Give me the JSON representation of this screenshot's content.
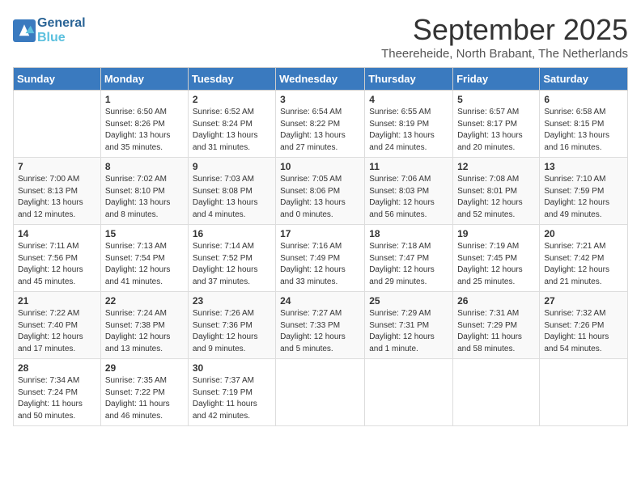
{
  "header": {
    "logo": {
      "line1": "General",
      "line2": "Blue"
    },
    "title": "September 2025",
    "location": "Theereheide, North Brabant, The Netherlands"
  },
  "days": [
    "Sunday",
    "Monday",
    "Tuesday",
    "Wednesday",
    "Thursday",
    "Friday",
    "Saturday"
  ],
  "weeks": [
    [
      {
        "num": "",
        "info": ""
      },
      {
        "num": "1",
        "info": "Sunrise: 6:50 AM\nSunset: 8:26 PM\nDaylight: 13 hours\nand 35 minutes."
      },
      {
        "num": "2",
        "info": "Sunrise: 6:52 AM\nSunset: 8:24 PM\nDaylight: 13 hours\nand 31 minutes."
      },
      {
        "num": "3",
        "info": "Sunrise: 6:54 AM\nSunset: 8:22 PM\nDaylight: 13 hours\nand 27 minutes."
      },
      {
        "num": "4",
        "info": "Sunrise: 6:55 AM\nSunset: 8:19 PM\nDaylight: 13 hours\nand 24 minutes."
      },
      {
        "num": "5",
        "info": "Sunrise: 6:57 AM\nSunset: 8:17 PM\nDaylight: 13 hours\nand 20 minutes."
      },
      {
        "num": "6",
        "info": "Sunrise: 6:58 AM\nSunset: 8:15 PM\nDaylight: 13 hours\nand 16 minutes."
      }
    ],
    [
      {
        "num": "7",
        "info": "Sunrise: 7:00 AM\nSunset: 8:13 PM\nDaylight: 13 hours\nand 12 minutes."
      },
      {
        "num": "8",
        "info": "Sunrise: 7:02 AM\nSunset: 8:10 PM\nDaylight: 13 hours\nand 8 minutes."
      },
      {
        "num": "9",
        "info": "Sunrise: 7:03 AM\nSunset: 8:08 PM\nDaylight: 13 hours\nand 4 minutes."
      },
      {
        "num": "10",
        "info": "Sunrise: 7:05 AM\nSunset: 8:06 PM\nDaylight: 13 hours\nand 0 minutes."
      },
      {
        "num": "11",
        "info": "Sunrise: 7:06 AM\nSunset: 8:03 PM\nDaylight: 12 hours\nand 56 minutes."
      },
      {
        "num": "12",
        "info": "Sunrise: 7:08 AM\nSunset: 8:01 PM\nDaylight: 12 hours\nand 52 minutes."
      },
      {
        "num": "13",
        "info": "Sunrise: 7:10 AM\nSunset: 7:59 PM\nDaylight: 12 hours\nand 49 minutes."
      }
    ],
    [
      {
        "num": "14",
        "info": "Sunrise: 7:11 AM\nSunset: 7:56 PM\nDaylight: 12 hours\nand 45 minutes."
      },
      {
        "num": "15",
        "info": "Sunrise: 7:13 AM\nSunset: 7:54 PM\nDaylight: 12 hours\nand 41 minutes."
      },
      {
        "num": "16",
        "info": "Sunrise: 7:14 AM\nSunset: 7:52 PM\nDaylight: 12 hours\nand 37 minutes."
      },
      {
        "num": "17",
        "info": "Sunrise: 7:16 AM\nSunset: 7:49 PM\nDaylight: 12 hours\nand 33 minutes."
      },
      {
        "num": "18",
        "info": "Sunrise: 7:18 AM\nSunset: 7:47 PM\nDaylight: 12 hours\nand 29 minutes."
      },
      {
        "num": "19",
        "info": "Sunrise: 7:19 AM\nSunset: 7:45 PM\nDaylight: 12 hours\nand 25 minutes."
      },
      {
        "num": "20",
        "info": "Sunrise: 7:21 AM\nSunset: 7:42 PM\nDaylight: 12 hours\nand 21 minutes."
      }
    ],
    [
      {
        "num": "21",
        "info": "Sunrise: 7:22 AM\nSunset: 7:40 PM\nDaylight: 12 hours\nand 17 minutes."
      },
      {
        "num": "22",
        "info": "Sunrise: 7:24 AM\nSunset: 7:38 PM\nDaylight: 12 hours\nand 13 minutes."
      },
      {
        "num": "23",
        "info": "Sunrise: 7:26 AM\nSunset: 7:36 PM\nDaylight: 12 hours\nand 9 minutes."
      },
      {
        "num": "24",
        "info": "Sunrise: 7:27 AM\nSunset: 7:33 PM\nDaylight: 12 hours\nand 5 minutes."
      },
      {
        "num": "25",
        "info": "Sunrise: 7:29 AM\nSunset: 7:31 PM\nDaylight: 12 hours\nand 1 minute."
      },
      {
        "num": "26",
        "info": "Sunrise: 7:31 AM\nSunset: 7:29 PM\nDaylight: 11 hours\nand 58 minutes."
      },
      {
        "num": "27",
        "info": "Sunrise: 7:32 AM\nSunset: 7:26 PM\nDaylight: 11 hours\nand 54 minutes."
      }
    ],
    [
      {
        "num": "28",
        "info": "Sunrise: 7:34 AM\nSunset: 7:24 PM\nDaylight: 11 hours\nand 50 minutes."
      },
      {
        "num": "29",
        "info": "Sunrise: 7:35 AM\nSunset: 7:22 PM\nDaylight: 11 hours\nand 46 minutes."
      },
      {
        "num": "30",
        "info": "Sunrise: 7:37 AM\nSunset: 7:19 PM\nDaylight: 11 hours\nand 42 minutes."
      },
      {
        "num": "",
        "info": ""
      },
      {
        "num": "",
        "info": ""
      },
      {
        "num": "",
        "info": ""
      },
      {
        "num": "",
        "info": ""
      }
    ]
  ]
}
